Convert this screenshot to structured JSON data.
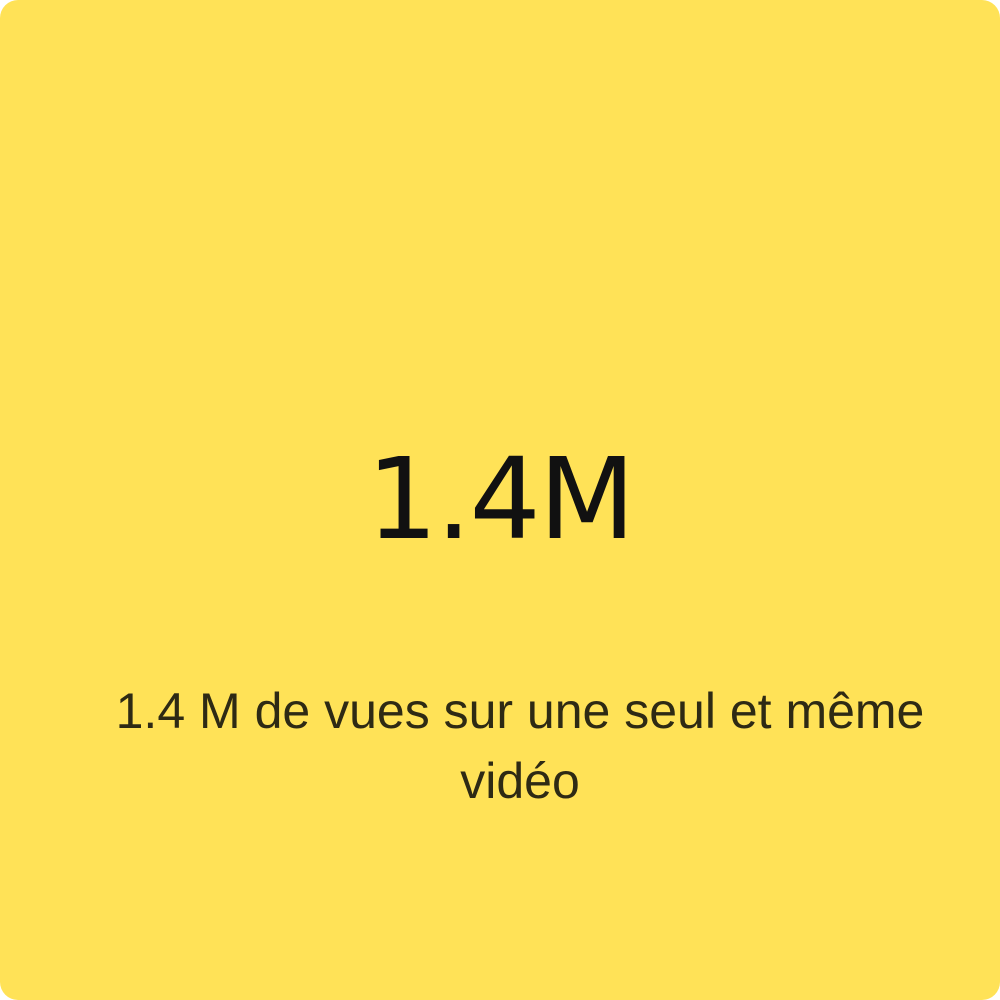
{
  "stat": {
    "value": "1.4M",
    "caption": "1.4 M de vues sur une seul et même vidéo"
  },
  "colors": {
    "background": "#FFE257",
    "value_text": "#111111",
    "caption_text": "#2E2A14"
  }
}
